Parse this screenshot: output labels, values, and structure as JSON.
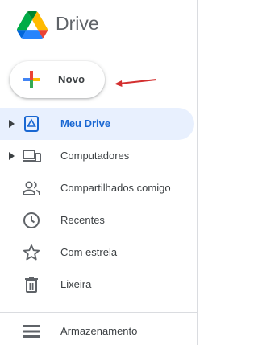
{
  "header": {
    "brand": "Drive",
    "logo_icon": "google-drive-logo"
  },
  "new_button": {
    "label": "Novo",
    "icon": "plus-icon",
    "colors": [
      "#ea4335",
      "#fbbc04",
      "#34a853",
      "#4285f4"
    ]
  },
  "annotation": {
    "type": "red-arrow",
    "color": "#d32f2f"
  },
  "nav": {
    "items": [
      {
        "label": "Meu Drive",
        "icon": "my-drive-icon",
        "active": true,
        "expandable": true
      },
      {
        "label": "Computadores",
        "icon": "computers-icon",
        "active": false,
        "expandable": true
      },
      {
        "label": "Compartilhados comigo",
        "icon": "shared-people-icon",
        "active": false,
        "expandable": false
      },
      {
        "label": "Recentes",
        "icon": "clock-icon",
        "active": false,
        "expandable": false
      },
      {
        "label": "Com estrela",
        "icon": "star-icon",
        "active": false,
        "expandable": false
      },
      {
        "label": "Lixeira",
        "icon": "trash-icon",
        "active": false,
        "expandable": false
      }
    ]
  },
  "storage": {
    "label": "Armazenamento",
    "icon": "storage-icon"
  },
  "colors": {
    "active_bg": "#e8f0fe",
    "active_text": "#1967d2",
    "text": "#3c4043",
    "icon": "#5f6368"
  }
}
